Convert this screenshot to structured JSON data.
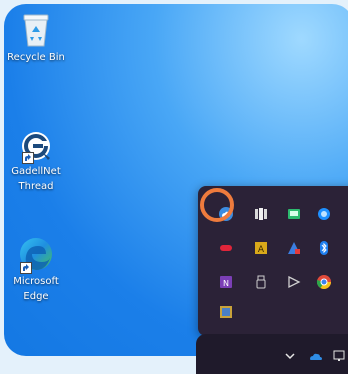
{
  "desktop": {
    "icons": [
      {
        "label": "Recycle Bin"
      },
      {
        "label": "GadellNet Thread"
      },
      {
        "label": "Microsoft Edge"
      }
    ]
  },
  "tray": {
    "icons": [
      "onedrive-icon",
      "app-icon",
      "app-icon",
      "app-icon",
      "app-icon",
      "app-icon",
      "app-icon",
      "bluetooth-icon",
      "onenote-icon",
      "usb-icon",
      "app-icon",
      "chrome-icon",
      "app-icon"
    ]
  },
  "colors": {
    "wallpaper": "#1b7fe9",
    "flyout": "#2b2237",
    "highlight": "#ee7b3d"
  }
}
